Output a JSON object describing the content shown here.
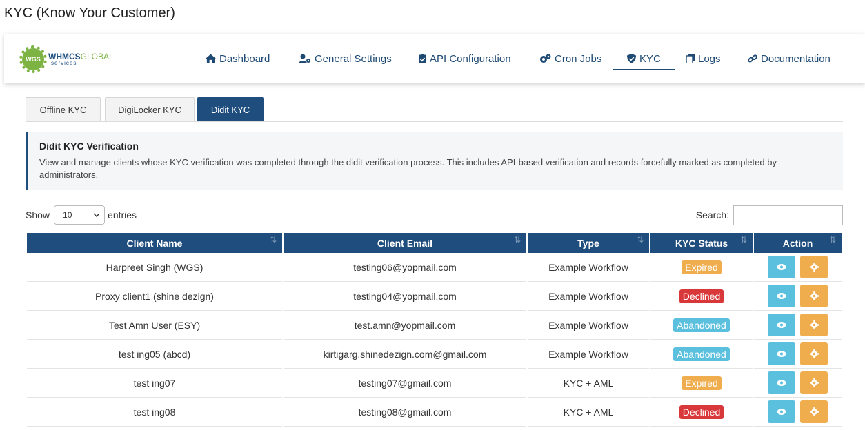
{
  "page": {
    "title": "KYC (Know Your Customer)"
  },
  "logo": {
    "brand": "WHMCS",
    "brand_accent": "GLOBAL",
    "sub": "services",
    "badge": "WGS"
  },
  "nav": [
    {
      "label": "Dashboard",
      "icon": "home-icon"
    },
    {
      "label": "General Settings",
      "icon": "user-cog-icon"
    },
    {
      "label": "API Configuration",
      "icon": "clipboard-check-icon"
    },
    {
      "label": "Cron Jobs",
      "icon": "cogs-icon"
    },
    {
      "label": "KYC",
      "icon": "shield-check-icon",
      "active": true
    },
    {
      "label": "Logs",
      "icon": "copy-icon"
    },
    {
      "label": "Documentation",
      "icon": "link-icon"
    }
  ],
  "tabs": [
    {
      "label": "Offline KYC"
    },
    {
      "label": "DigiLocker KYC"
    },
    {
      "label": "Didit KYC",
      "active": true
    }
  ],
  "info": {
    "title": "Didit KYC Verification",
    "text": "View and manage clients whose KYC verification was completed through the didit verification process. This includes API-based verification and records forcefully marked as completed by administrators."
  },
  "controls": {
    "show_label": "Show",
    "entries_value": "10",
    "entries_label": "entries",
    "search_label": "Search:"
  },
  "table": {
    "headers": [
      "Client Name",
      "Client Email",
      "Type",
      "KYC Status",
      "Action"
    ],
    "rows": [
      {
        "name": "Harpreet Singh (WGS)",
        "email": "testing06@yopmail.com",
        "type": "Example Workflow",
        "status": "Expired"
      },
      {
        "name": "Proxy client1 (shine dezign)",
        "email": "testing04@yopmail.com",
        "type": "Example Workflow",
        "status": "Declined"
      },
      {
        "name": "Test Amn User (ESY)",
        "email": "test.amn@yopmail.com",
        "type": "Example Workflow",
        "status": "Abandoned"
      },
      {
        "name": "test ing05 (abcd)",
        "email": "kirtigarg.shinedezign.com@gmail.com",
        "type": "Example Workflow",
        "status": "Abandoned"
      },
      {
        "name": "test ing07",
        "email": "testing07@gmail.com",
        "type": "KYC + AML",
        "status": "Expired"
      },
      {
        "name": "test ing08",
        "email": "testing08@gmail.com",
        "type": "KYC + AML",
        "status": "Declined"
      }
    ]
  },
  "colors": {
    "primary": "#1f4d7d",
    "expired": "#f0ad4e",
    "declined": "#d9383a",
    "abandoned": "#5bc0de"
  }
}
